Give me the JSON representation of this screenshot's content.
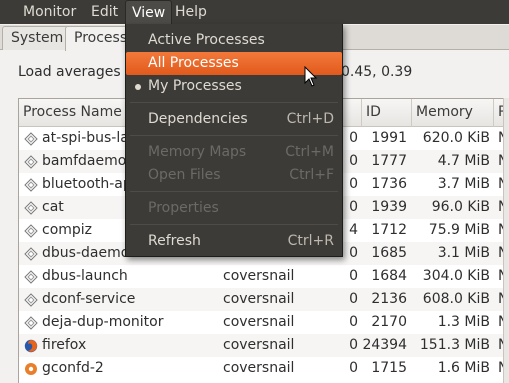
{
  "menubar": {
    "items": [
      {
        "label": "Monitor"
      },
      {
        "label": "Edit"
      },
      {
        "label": "View"
      },
      {
        "label": "Help"
      }
    ]
  },
  "tabs": [
    {
      "label": "System"
    },
    {
      "label": "Process"
    }
  ],
  "load_averages": {
    "label": "Load averages f",
    "tail": "0.45, 0.39"
  },
  "table": {
    "headers": [
      "Process Name",
      "",
      "ID",
      "Memory",
      "Pr"
    ],
    "rows": [
      {
        "name": "at-spi-bus-lau",
        "user": "",
        "nice": "0",
        "id": "1991",
        "memory": "620.0 KiB",
        "priority": "N"
      },
      {
        "name": "bamfdaemo",
        "user": "",
        "nice": "0",
        "id": "1777",
        "memory": "4.7 MiB",
        "priority": "N"
      },
      {
        "name": "bluetooth-ap",
        "user": "",
        "nice": "0",
        "id": "1736",
        "memory": "3.7 MiB",
        "priority": "N"
      },
      {
        "name": "cat",
        "user": "",
        "nice": "0",
        "id": "1939",
        "memory": "96.0 KiB",
        "priority": "N"
      },
      {
        "name": "compiz",
        "user": "",
        "nice": "4",
        "id": "1712",
        "memory": "75.9 MiB",
        "priority": "N"
      },
      {
        "name": "dbus-daemo",
        "user": "",
        "nice": "0",
        "id": "1685",
        "memory": "3.1 MiB",
        "priority": "N"
      },
      {
        "name": "dbus-launch",
        "user": "coversnail",
        "nice": "0",
        "id": "1684",
        "memory": "304.0 KiB",
        "priority": "N"
      },
      {
        "name": "dconf-service",
        "user": "coversnail",
        "nice": "0",
        "id": "2136",
        "memory": "608.0 KiB",
        "priority": "N"
      },
      {
        "name": "deja-dup-monitor",
        "user": "coversnail",
        "nice": "0",
        "id": "2170",
        "memory": "1.3 MiB",
        "priority": "N"
      },
      {
        "name": "firefox",
        "user": "coversnail",
        "nice": "0",
        "id": "24394",
        "memory": "151.3 MiB",
        "priority": "N"
      },
      {
        "name": "gconfd-2",
        "user": "coversnail",
        "nice": "0",
        "id": "1715",
        "memory": "1.6 MiB",
        "priority": "N"
      }
    ]
  },
  "view_menu": {
    "items": [
      {
        "label": "Active Processes",
        "accel": ""
      },
      {
        "label": "All Processes",
        "accel": ""
      },
      {
        "label": "My Processes",
        "accel": ""
      },
      {
        "label": "Dependencies",
        "accel": "Ctrl+D"
      },
      {
        "label": "Memory Maps",
        "accel": "Ctrl+M"
      },
      {
        "label": "Open Files",
        "accel": "Ctrl+F"
      },
      {
        "label": "Properties",
        "accel": ""
      },
      {
        "label": "Refresh",
        "accel": "Ctrl+R"
      }
    ]
  },
  "colors": {
    "menubar_bg": "#3c3b37",
    "highlight": "#e15a1c",
    "window_bg": "#f2f1f0"
  }
}
